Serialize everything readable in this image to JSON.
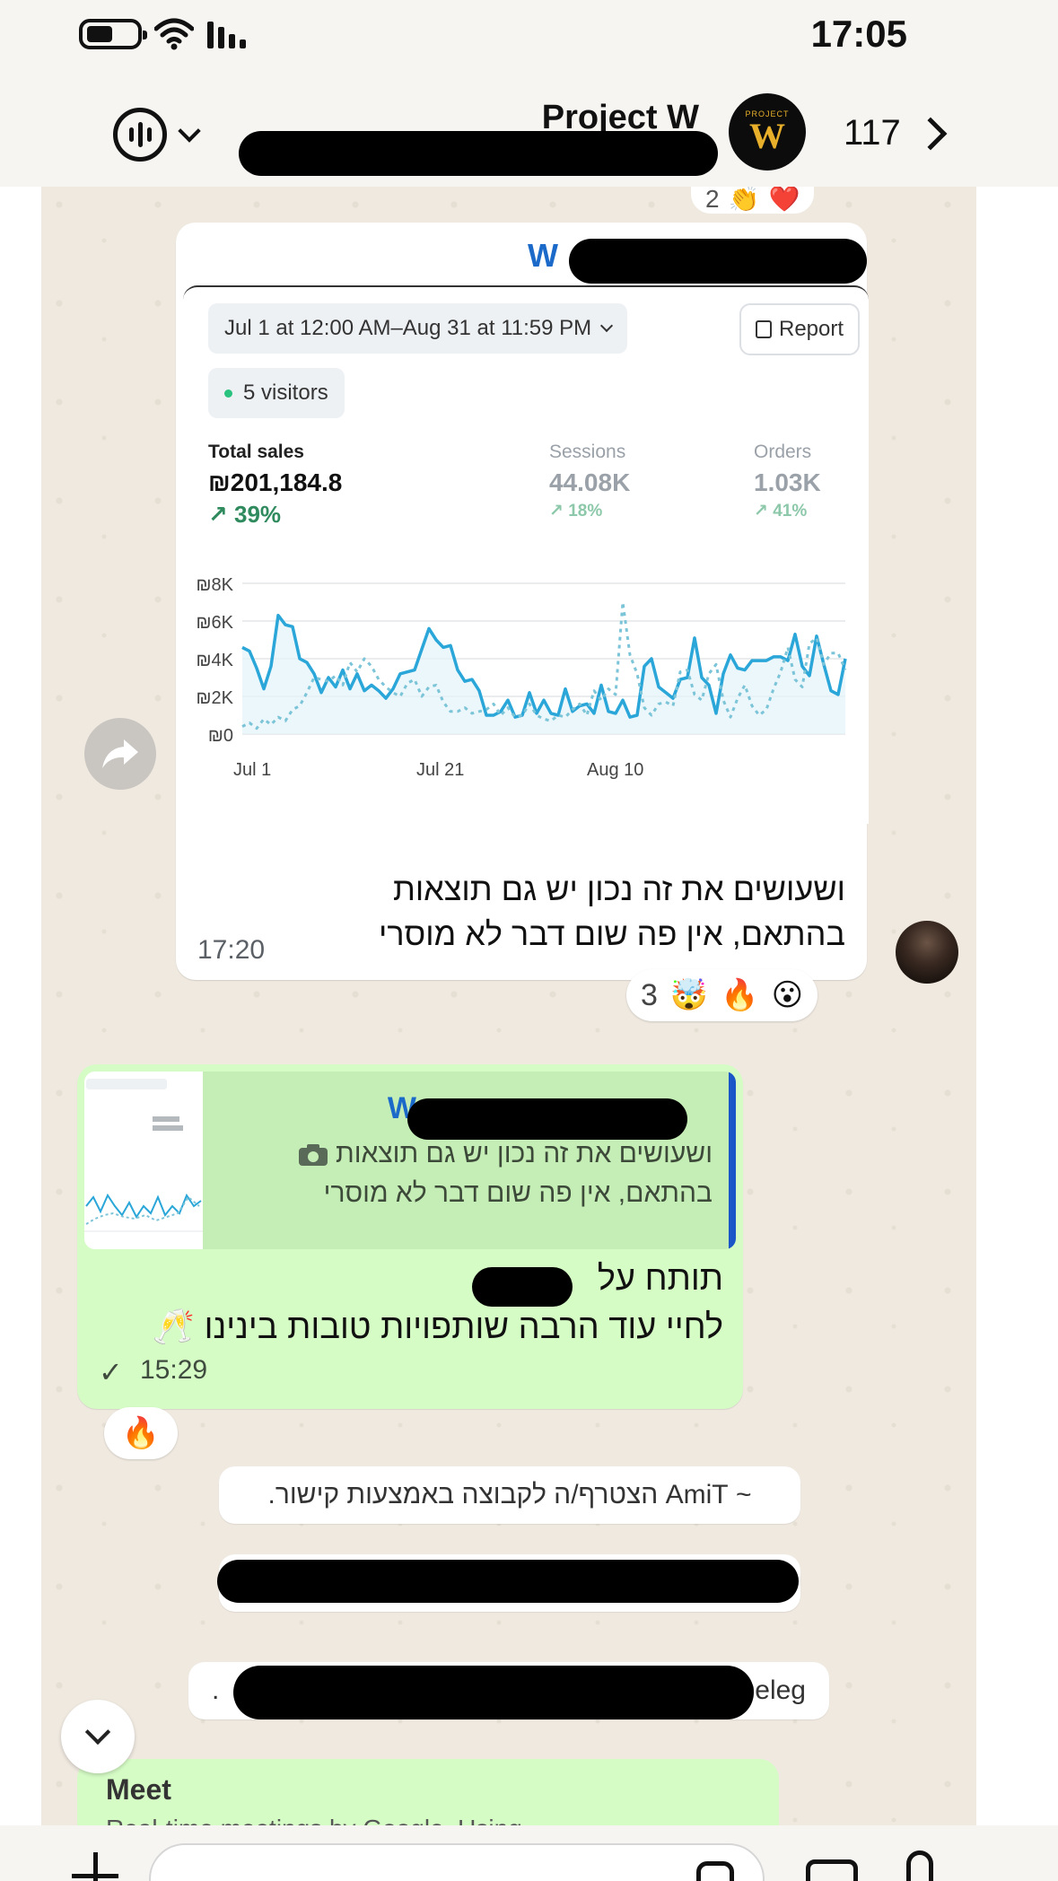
{
  "status": {
    "time": "17:05"
  },
  "header": {
    "group_name": "Project W",
    "member_count": "117",
    "avatar_text": "W",
    "avatar_small": "PROJECT"
  },
  "message1": {
    "sender": "W",
    "dashboard": {
      "date_range": "Jul 1 at 12:00 AM–Aug 31 at 11:59 PM",
      "report_label": "Report",
      "visitors": "5 visitors",
      "metrics": [
        {
          "label": "Total sales",
          "value": "₪201,184.8",
          "change": "↗ 39%"
        },
        {
          "label": "Sessions",
          "value": "44.08K",
          "change": "↗ 18%"
        },
        {
          "label": "Orders",
          "value": "1.03K",
          "change": "↗ 41%"
        }
      ]
    },
    "text_line1": "ושעושים את זה נכון יש גם תוצאות",
    "text_line2": "בהתאם, אין פה שום דבר לא מוסרי",
    "time": "17:20",
    "reactions_count": "3",
    "reactions": [
      "🤯",
      "🔥",
      "😮"
    ],
    "reactions_prev_count": "2",
    "reactions_prev": [
      "👏",
      "❤️"
    ]
  },
  "message2": {
    "quote_sender": "W",
    "quote_line1": "ושעושים את זה נכון יש גם תוצאות",
    "quote_line2": "בהתאם, אין פה שום דבר לא מוסרי",
    "quote_icon": "camera-icon",
    "line1": "תותח על",
    "line2": "לחיי עוד הרבה שותפויות טובות בינינו 🥂",
    "tick": "✓",
    "time": "15:29",
    "reaction": "🔥"
  },
  "system": {
    "joined": "~ AmiT הצטרף/ה לקבוצה באמצעות קישור.",
    "joined3_tail": "Deleg ~",
    "joined3_head": "."
  },
  "meet": {
    "title": "Meet",
    "desc": "Real-time meetings by Google. Using..."
  },
  "chart_data": {
    "type": "line",
    "x_ticks": [
      "Jul 1",
      "Jul 21",
      "Aug 10"
    ],
    "y_ticks": [
      "₪8K",
      "₪6K",
      "₪4K",
      "₪2K",
      "₪0"
    ],
    "ylim": [
      0,
      8000
    ],
    "series": [
      {
        "style": "solid",
        "color": "#2aa6d8",
        "values": [
          4600,
          4400,
          3500,
          2400,
          3600,
          6300,
          5800,
          5700,
          4000,
          3800,
          3200,
          2200,
          3000,
          2500,
          3400,
          2400,
          3200,
          2300,
          2600,
          2300,
          1900,
          2400,
          3200,
          3300,
          3400,
          4500,
          5600,
          5000,
          4600,
          4700,
          3400,
          2800,
          2900,
          2300,
          1000,
          1000,
          1200,
          1800,
          900,
          1000,
          2200,
          1100,
          1800,
          1100,
          1000,
          2400,
          1200,
          1500,
          1600,
          1100,
          2600,
          1200,
          1100,
          1800,
          900,
          1000,
          3600,
          4000,
          2500,
          2200,
          1900,
          2900,
          3000,
          5100,
          3000,
          2600,
          1100,
          3200,
          4200,
          3500,
          3400,
          3900,
          3900,
          3900,
          4100,
          4100,
          3900,
          5300,
          3600,
          3100,
          5200,
          3700,
          2300,
          2100,
          4000
        ]
      },
      {
        "style": "dashed",
        "color": "#7cc4d8",
        "values": [
          400,
          600,
          300,
          800,
          500,
          900,
          700,
          1300,
          1500,
          2200,
          3000,
          2900,
          2800,
          3100,
          2600,
          3800,
          3300,
          4000,
          3600,
          2900,
          2500,
          2200,
          2000,
          2700,
          2900,
          2000,
          2500,
          2600,
          1700,
          1200,
          1200,
          1400,
          1100,
          1200,
          1300,
          1600,
          1000,
          1400,
          900,
          1000,
          1600,
          1000,
          800,
          700,
          1000,
          900,
          1300,
          1600,
          1000,
          2300,
          1800,
          2400,
          2100,
          7000,
          4200,
          3200,
          1400,
          1000,
          1600,
          1700,
          1500,
          3300,
          3400,
          2100,
          1800,
          3200,
          3700,
          1800,
          900,
          1900,
          2600,
          1500,
          1000,
          1300,
          2400,
          3300,
          4600,
          2900,
          2500,
          4800,
          5100,
          3700,
          4300,
          4300,
          3400
        ]
      }
    ]
  }
}
